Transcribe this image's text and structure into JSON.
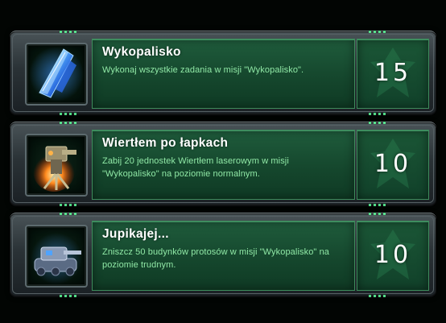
{
  "achievements": [
    {
      "title": "Wykopalisko",
      "description": "Wykonaj wszystkie zadania w misji \"Wykopalisko\".",
      "points": "15",
      "icon": "blue-crystal-shard-icon"
    },
    {
      "title": "Wiertłem po łapkach",
      "description": "Zabij 20 jednostek Wiertłem laserowym w misji \"Wykopalisko\" na poziomie normalnym.",
      "points": "10",
      "icon": "laser-drill-icon"
    },
    {
      "title": "Jupikajej...",
      "description": "Zniszcz 50 budynków protosów w misji \"Wykopalisko\" na poziomie trudnym.",
      "points": "10",
      "icon": "siege-tank-icon"
    }
  ],
  "colors": {
    "panel_green": "#15472d",
    "description_text": "#8fe7a5",
    "title_text": "#ffffff"
  }
}
